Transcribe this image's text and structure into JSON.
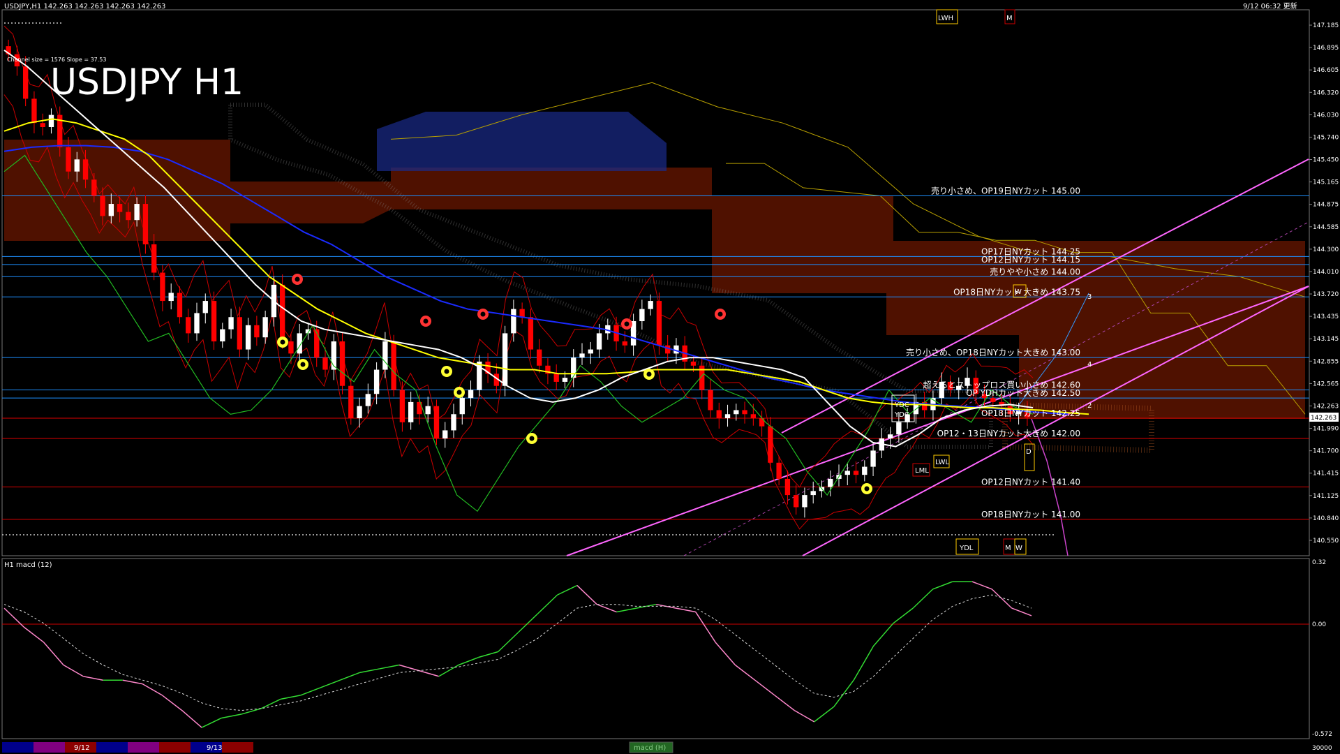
{
  "header": {
    "symbol_info": "USDJPY,H1  142.263 142.263 142.263 142.263",
    "timestamp": "9/12 06:32 更新",
    "big_title": "USDJPY H1",
    "channel_info": "Channel size = 1576 Slope = 37.53"
  },
  "sub_window": {
    "label": "H1  macd (12)",
    "scale_top": "0.32",
    "scale_zero": "0.00",
    "scale_bottom": "-0.572"
  },
  "bottom_bar": {
    "date1": "9/12",
    "date2": "9/13",
    "tab": "macd (H)",
    "right_value": "30000",
    "colors": [
      "#00008b",
      "#800080",
      "#8b0000",
      "#00008b",
      "#800080",
      "#8b0000",
      "#00008b",
      "#8b0000"
    ]
  },
  "colors": {
    "ma_white": "#ffffff",
    "ma_yellow": "#ffff00",
    "ma_blue": "#1a2bff",
    "lag_green": "#22bb22",
    "bb_red": "#cc0000",
    "kumo_red": "#cc3300",
    "kumo_blue": "#3366ff",
    "channel": "#ff66ff",
    "hline_blue": "#1e90ff",
    "hline_red": "#dd0000",
    "macd_up": "#33dd33",
    "macd_down": "#ff88cc"
  },
  "price_axis": {
    "labels": [
      "147.185",
      "146.895",
      "146.605",
      "146.320",
      "146.030",
      "145.740",
      "145.450",
      "145.165",
      "144.875",
      "144.585",
      "144.300",
      "144.010",
      "143.720",
      "143.435",
      "143.145",
      "142.855",
      "142.565",
      "142.263",
      "141.990",
      "141.700",
      "141.415",
      "141.125",
      "140.840",
      "140.550"
    ],
    "current": "142.263"
  },
  "levels": [
    {
      "label": "売り小さめ、OP19日NYカット 145.00",
      "price": 145.0,
      "color": "blue"
    },
    {
      "label": "OP17日NYカット 144.25",
      "price": 144.25,
      "color": "blue"
    },
    {
      "label": "OP12日NYカット 144.15",
      "price": 144.15,
      "color": "blue"
    },
    {
      "label": "売りやや小さめ 144.00",
      "price": 144.0,
      "color": "blue"
    },
    {
      "label": "OP18日NYカット 大きめ 143.75",
      "price": 143.75,
      "color": "blue"
    },
    {
      "label": "売り小さめ、OP18日NYカット大きめ 143.00",
      "price": 143.0,
      "color": "blue"
    },
    {
      "label": "超えるとストップロス買い小さめ 142.60",
      "price": 142.6,
      "color": "blue"
    },
    {
      "label": "OP YDHカット大きめ 142.50",
      "price": 142.5,
      "color": "blue"
    },
    {
      "label": "OP18日NYカット 142.25",
      "price": 142.25,
      "color": "red"
    },
    {
      "label": "OP12・13日NYカット大きめ 142.00",
      "price": 142.0,
      "color": "red"
    },
    {
      "label": "OP12日NYカット 141.40",
      "price": 141.4,
      "color": "red"
    },
    {
      "label": "OP18日NYカット 141.00",
      "price": 141.0,
      "color": "red"
    }
  ],
  "markers": {
    "ydc": "YDC",
    "ydh": "YDH",
    "ydl": "YDL",
    "lml": "LML",
    "lwl": "LWL",
    "lwh": "LWH",
    "m": "M",
    "w": "W",
    "d": "D",
    "wave_labels": [
      "3",
      "4",
      "2"
    ]
  },
  "chart_data": {
    "type": "candlestick",
    "title": "USDJPY H1",
    "ylim": [
      140.55,
      147.3
    ],
    "close_path": [
      146.75,
      146.6,
      146.2,
      145.9,
      145.85,
      146.0,
      145.6,
      145.3,
      145.45,
      145.2,
      145.0,
      144.75,
      144.9,
      144.8,
      144.7,
      144.9,
      144.4,
      144.05,
      143.7,
      143.8,
      143.5,
      143.3,
      143.55,
      143.7,
      143.2,
      143.35,
      143.5,
      143.1,
      143.4,
      143.25,
      143.5,
      143.9,
      143.2,
      143.05,
      143.3,
      143.35,
      143.0,
      142.85,
      143.2,
      142.65,
      142.25,
      142.4,
      142.55,
      142.85,
      143.2,
      142.6,
      142.2,
      142.45,
      142.3,
      142.4,
      142.0,
      142.1,
      142.3,
      142.5,
      142.6,
      142.95,
      142.8,
      142.65,
      143.3,
      143.6,
      143.5,
      143.1,
      142.9,
      142.8,
      142.7,
      142.75,
      143.0,
      143.05,
      143.1,
      143.3,
      143.4,
      143.2,
      143.15,
      143.45,
      143.6,
      143.7,
      143.15,
      143.05,
      143.15,
      142.95,
      142.9,
      142.6,
      142.35,
      142.25,
      142.3,
      142.35,
      142.3,
      142.25,
      142.15,
      141.7,
      141.5,
      141.3,
      141.15,
      141.3,
      141.35,
      141.4,
      141.5,
      141.55,
      141.6,
      141.55,
      141.65,
      141.85,
      142.0,
      142.05,
      142.2,
      142.3,
      142.45,
      142.35,
      142.5,
      142.7,
      142.6,
      142.65,
      142.75,
      142.55,
      142.5,
      142.45,
      142.4,
      142.3,
      142.35,
      142.26
    ],
    "ma_white": [
      146.8,
      146.6,
      146.35,
      146.1,
      145.85,
      145.6,
      145.35,
      145.1,
      144.8,
      144.5,
      144.2,
      143.9,
      143.65,
      143.45,
      143.35,
      143.3,
      143.25,
      143.2,
      143.15,
      143.1,
      143.0,
      142.85,
      142.65,
      142.5,
      142.45,
      142.5,
      142.6,
      142.75,
      142.85,
      142.95,
      143.0,
      143.0,
      142.95,
      142.9,
      142.85,
      142.75,
      142.45,
      142.15,
      141.95,
      141.9,
      142.05,
      142.25,
      142.35,
      142.4,
      142.42,
      142.38
    ],
    "ma_yellow": [
      145.8,
      145.9,
      145.95,
      145.9,
      145.8,
      145.7,
      145.5,
      145.2,
      144.9,
      144.6,
      144.3,
      144.0,
      143.8,
      143.6,
      143.45,
      143.3,
      143.2,
      143.1,
      143.0,
      142.95,
      142.9,
      142.85,
      142.85,
      142.8,
      142.8,
      142.8,
      142.82,
      142.85,
      142.85,
      142.85,
      142.85,
      142.8,
      142.75,
      142.7,
      142.6,
      142.5,
      142.45,
      142.42,
      142.42,
      142.4,
      142.38,
      142.38,
      142.36,
      142.35,
      142.32,
      142.3
    ],
    "ma_blue": [
      145.55,
      145.6,
      145.62,
      145.62,
      145.6,
      145.55,
      145.45,
      145.3,
      145.15,
      144.95,
      144.75,
      144.55,
      144.4,
      144.2,
      144.0,
      143.85,
      143.7,
      143.6,
      143.55,
      143.5,
      143.45,
      143.4,
      143.35,
      143.25,
      143.15,
      143.05,
      142.95,
      142.85,
      142.75,
      142.68,
      142.6,
      142.55,
      142.5,
      142.45,
      142.42,
      142.4,
      142.38,
      142.35,
      142.32,
      142.3
    ],
    "lagging_span": [
      145.3,
      145.5,
      145.1,
      144.7,
      144.3,
      144.0,
      143.6,
      143.2,
      143.3,
      142.9,
      142.5,
      142.3,
      142.35,
      142.6,
      143.0,
      143.4,
      142.9,
      142.7,
      143.1,
      142.8,
      142.6,
      141.9,
      141.3,
      141.1,
      141.5,
      141.9,
      142.2,
      142.5,
      142.9,
      142.7,
      142.4,
      142.2,
      142.35,
      142.5,
      142.8,
      142.6,
      142.5,
      142.2,
      142.0,
      141.6,
      141.3,
      141.7,
      142.1,
      142.6,
      142.3,
      142.5,
      142.35,
      142.2,
      142.6,
      142.4,
      142.3
    ],
    "macd": [
      0.08,
      -0.02,
      -0.1,
      -0.22,
      -0.28,
      -0.3,
      -0.3,
      -0.32,
      -0.38,
      -0.46,
      -0.55,
      -0.5,
      -0.48,
      -0.45,
      -0.4,
      -0.38,
      -0.34,
      -0.3,
      -0.26,
      -0.24,
      -0.22,
      -0.25,
      -0.28,
      -0.22,
      -0.18,
      -0.15,
      -0.05,
      0.05,
      0.15,
      0.2,
      0.1,
      0.06,
      0.08,
      0.1,
      0.08,
      0.06,
      -0.1,
      -0.22,
      -0.3,
      -0.38,
      -0.46,
      -0.52,
      -0.44,
      -0.3,
      -0.12,
      0.0,
      0.08,
      0.18,
      0.22,
      0.22,
      0.18,
      0.08,
      0.04
    ],
    "signal": [
      0.1,
      0.06,
      0.0,
      -0.08,
      -0.16,
      -0.22,
      -0.27,
      -0.3,
      -0.33,
      -0.37,
      -0.42,
      -0.45,
      -0.46,
      -0.45,
      -0.43,
      -0.41,
      -0.38,
      -0.35,
      -0.32,
      -0.29,
      -0.26,
      -0.25,
      -0.24,
      -0.23,
      -0.21,
      -0.19,
      -0.14,
      -0.08,
      0.0,
      0.08,
      0.1,
      0.1,
      0.09,
      0.09,
      0.09,
      0.08,
      0.02,
      -0.06,
      -0.14,
      -0.22,
      -0.3,
      -0.37,
      -0.39,
      -0.36,
      -0.28,
      -0.18,
      -0.08,
      0.02,
      0.09,
      0.13,
      0.15,
      0.12,
      0.08
    ],
    "macd_ylim": [
      -0.572,
      0.32
    ]
  }
}
